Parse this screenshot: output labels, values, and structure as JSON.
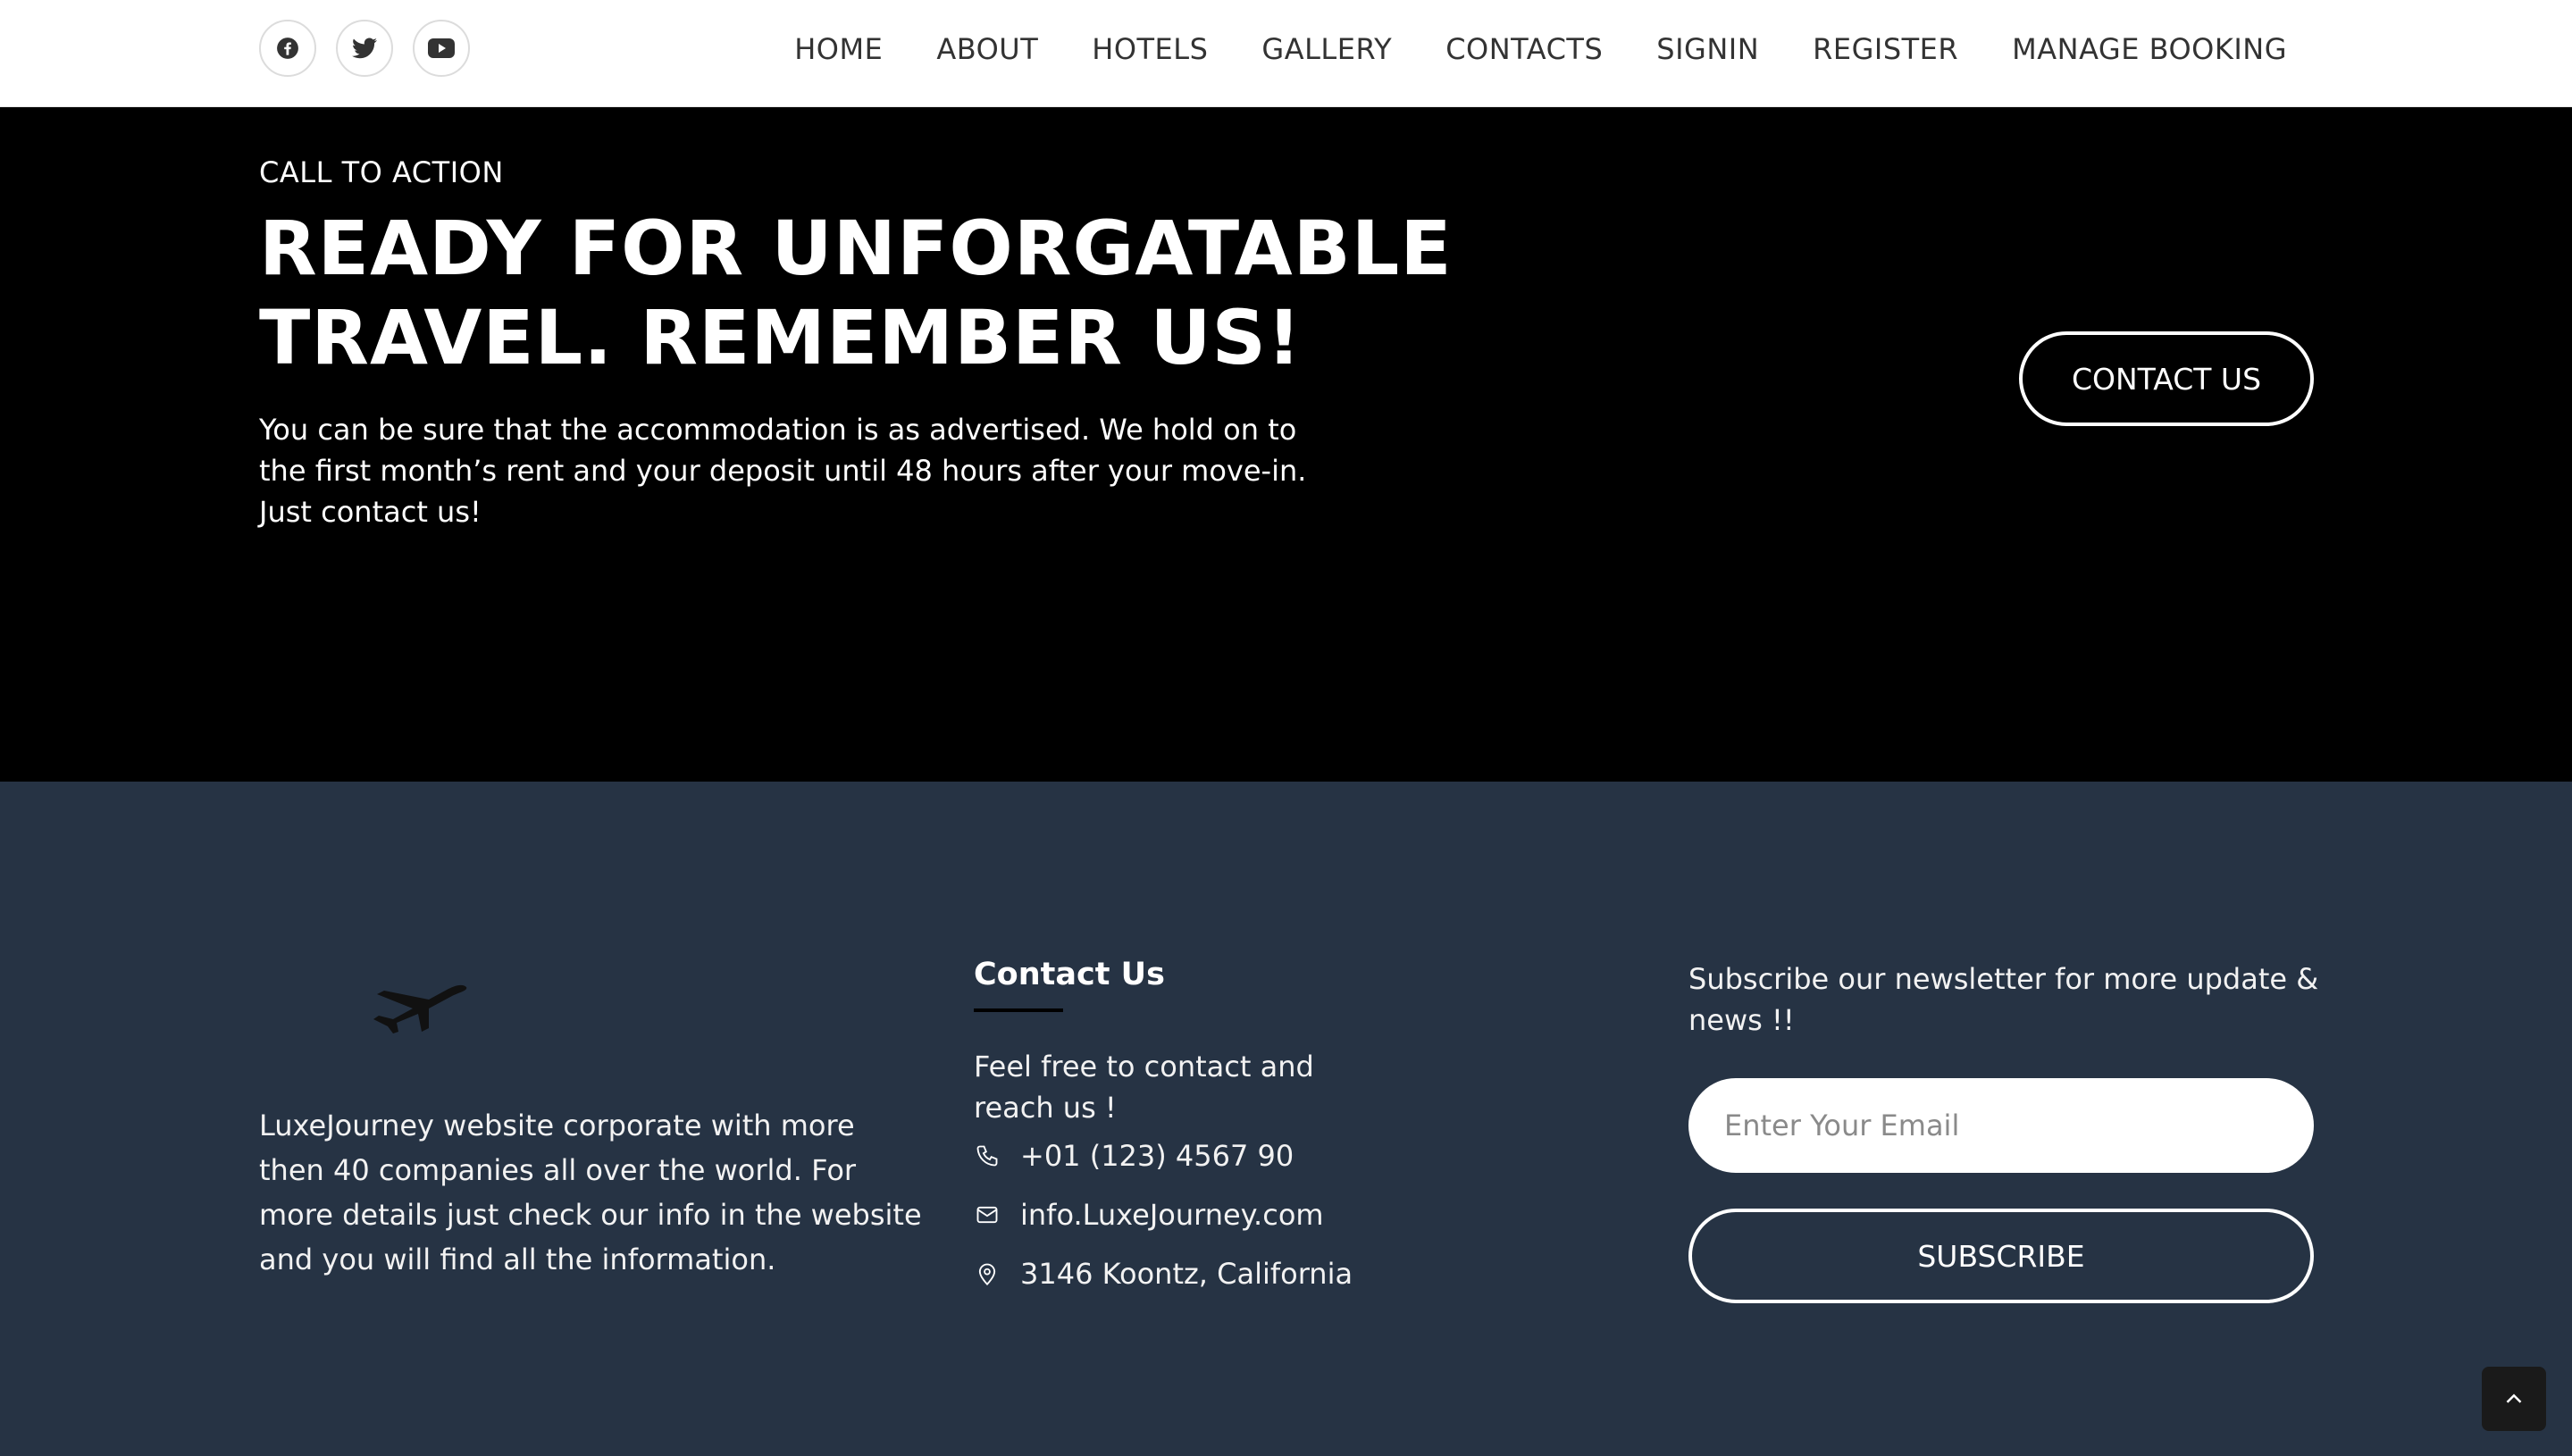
{
  "header": {
    "social": [
      {
        "icon": "facebook-icon"
      },
      {
        "icon": "twitter-icon"
      },
      {
        "icon": "youtube-icon"
      }
    ],
    "nav": [
      "HOME",
      "ABOUT",
      "HOTELS",
      "GALLERY",
      "CONTACTS",
      "SIGNIN",
      "REGISTER",
      "MANAGE BOOKING"
    ]
  },
  "cta": {
    "eyebrow": "CALL TO ACTION",
    "title_lines": [
      "READY FOR UNFORGATABLE",
      "TRAVEL. REMEMBER US!"
    ],
    "description_lines": [
      "You can be sure that the accommodation is as advertised. We hold on to",
      "the first month’s rent and your deposit until 48 hours after your move-in.",
      "Just contact us!"
    ],
    "button_label": "CONTACT US"
  },
  "footer": {
    "logo_icon": "airplane-icon",
    "about_lines": [
      "LuxeJourney website corporate with more",
      "then 40 companies all over the world. For",
      "more details just check our info in the website",
      "and you will find all the information."
    ],
    "contact": {
      "title": "Contact Us",
      "description_lines": [
        "Feel free to contact and",
        "reach us !"
      ],
      "phone": "+01 (123) 4567 90",
      "email": "info.LuxeJourney.com",
      "address": "3146 Koontz, California"
    },
    "newsletter": {
      "text_lines": [
        "Subscribe our newsletter for more update &",
        "news !!"
      ],
      "email_placeholder": "Enter Your Email",
      "subscribe_label": "SUBSCRIBE"
    },
    "scroll_top_icon": "chevron-up-icon"
  },
  "colors": {
    "header_bg": "#ffffff",
    "cta_bg": "#000000",
    "footer_bg": "#263344",
    "text_light": "#ffffff"
  }
}
